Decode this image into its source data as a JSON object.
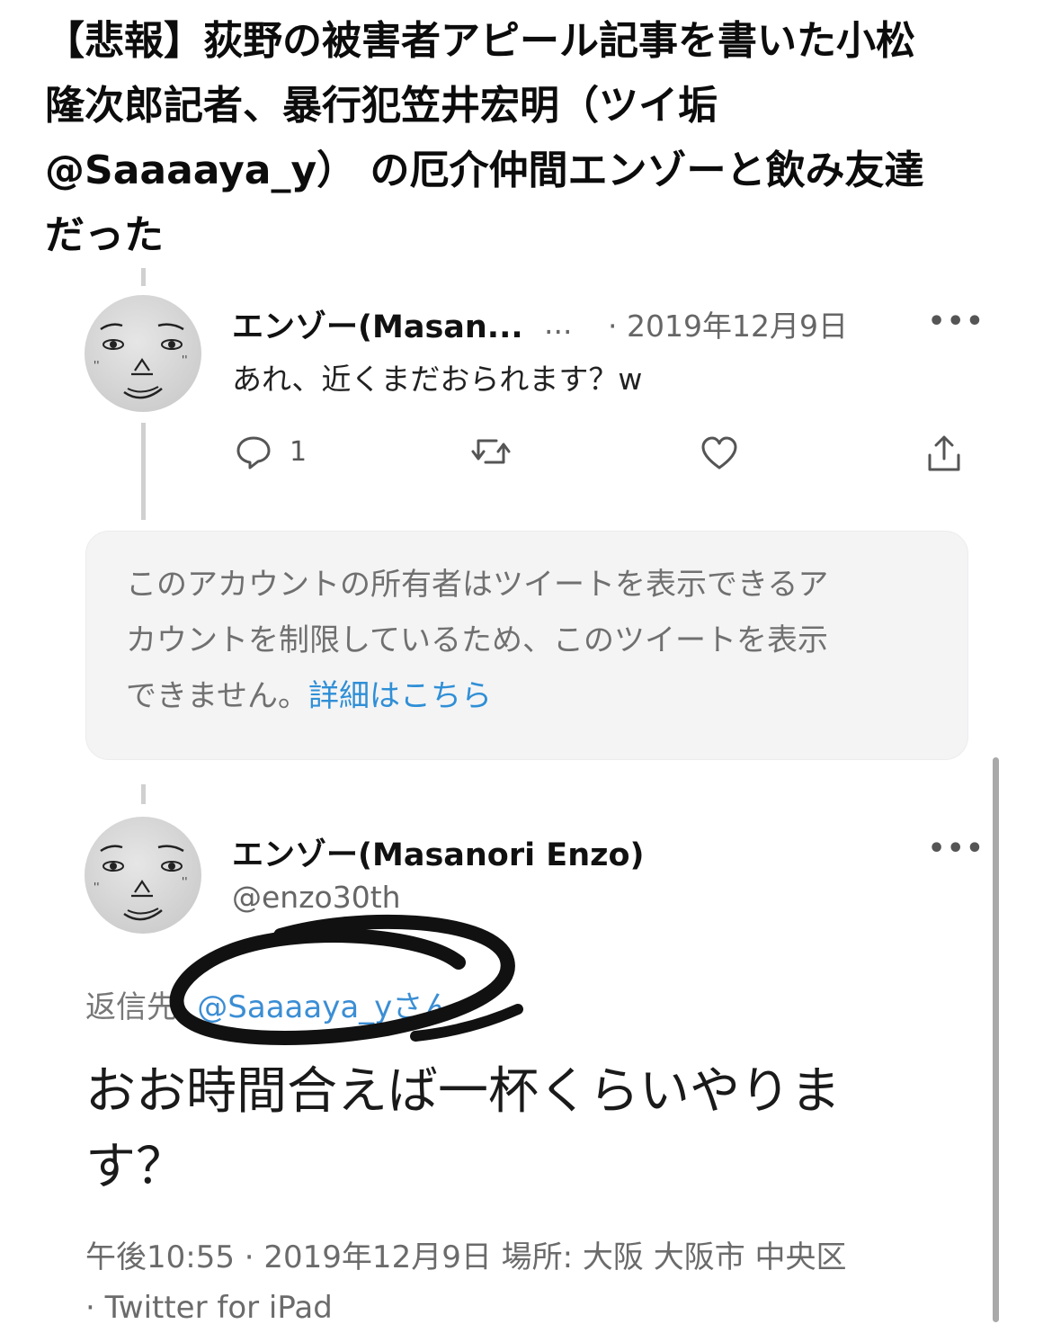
{
  "headline": {
    "line1": "【悲報】荻野の被害者アピール記事を書いた小松",
    "line2": "隆次郎記者、暴行犯笠井宏明（ツイ垢",
    "line3": "@Saaaaya_y） の厄介仲間エンゾーと飲み友達",
    "line4": "だった"
  },
  "tweet1": {
    "name": "エンゾー(Masan...",
    "handle_truncated": "...",
    "date": "· 2019年12月9日",
    "more": "•••",
    "text": "あれ、近くまだおられます？w",
    "reply_count": "1",
    "icons": [
      "reply-icon",
      "retweet-icon",
      "like-icon",
      "share-icon"
    ]
  },
  "notice": {
    "line1": "このアカウントの所有者はツイートを表示できるア",
    "line2": "カウントを制限しているため、このツイートを表示",
    "line3_prefix": "できません。",
    "link": "詳細はこちら"
  },
  "tweet2": {
    "name": "エンゾー(Masanori Enzo)",
    "handle": "@enzo30th",
    "more": "•••",
    "reply_to_label": "返信先:",
    "reply_to_handle": "@Saaaaya_yさん",
    "text_line1": "おお時間合えば一杯くらいやりま",
    "text_line2": "す？",
    "meta_line1": "午後10:55 · 2019年12月9日 場所: 大阪 大阪市 中央区",
    "meta_line2": "· Twitter for iPad"
  },
  "colors": {
    "link": "#2f8fd6",
    "annotation_ink": "#111111",
    "notice_bg": "#f4f4f5"
  }
}
